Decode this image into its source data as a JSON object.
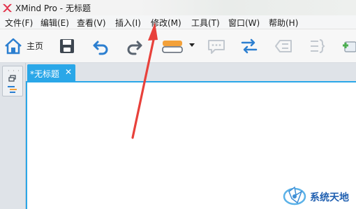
{
  "window": {
    "title": "XMind Pro - 无标题"
  },
  "menu": {
    "items": [
      "文件(F)",
      "编辑(E)",
      "查看(V)",
      "插入(I)",
      "修改(M)",
      "工具(T)",
      "窗口(W)",
      "帮助(H)"
    ]
  },
  "toolbar": {
    "home_label": "主页",
    "icons": [
      "home-icon",
      "save-icon",
      "undo-icon",
      "redo-icon",
      "topic-style-icon",
      "comment-icon",
      "relationship-icon",
      "boundary-icon",
      "summary-icon",
      "add-topic-icon"
    ]
  },
  "tabs": [
    {
      "label": "*无标题",
      "active": true
    }
  ],
  "watermark": {
    "text": "系统天地"
  },
  "colors": {
    "accent": "#2aa7e8",
    "annotation": "#e8413b",
    "logo": "#e2314a",
    "watermark": "#1f5fb0"
  }
}
